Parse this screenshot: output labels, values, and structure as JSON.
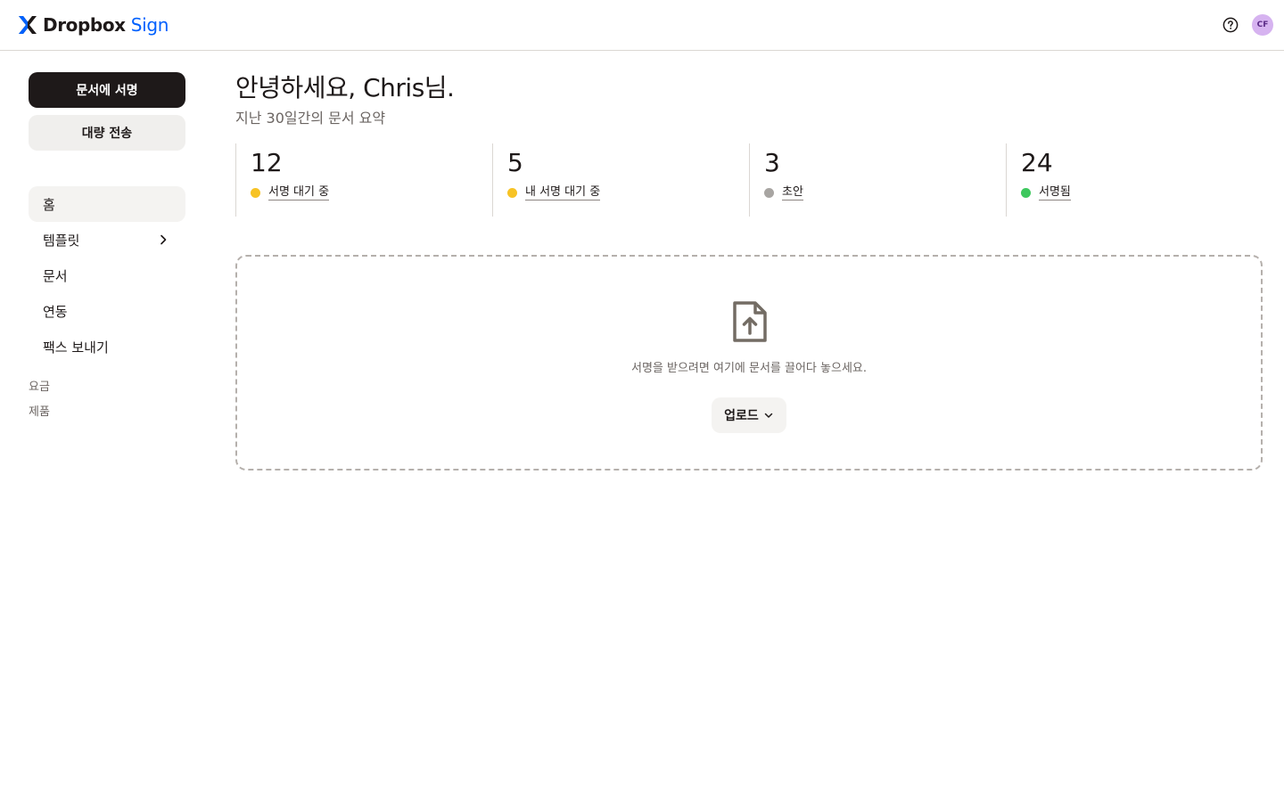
{
  "header": {
    "logo_text": "Dropbox",
    "logo_product": "Sign",
    "help_icon": "question-circle-icon",
    "avatar_initials": "CF",
    "avatar_color": "#d6b3f0"
  },
  "sidebar": {
    "primary_button": "문서에 서명",
    "secondary_button": "대량 전송",
    "nav_items": [
      {
        "label": "홈",
        "active": true
      },
      {
        "label": "템플릿",
        "icon": "chevron-right-icon"
      },
      {
        "label": "문서"
      },
      {
        "label": "연동"
      },
      {
        "label": "팩스 보내기"
      }
    ],
    "secondary_links": [
      "요금",
      "제품"
    ]
  },
  "main": {
    "greeting": "안녕하세요, Chris님.",
    "subtitle": "지난 30일간의 문서 요약",
    "stats": [
      {
        "count": "12",
        "label": "서명 대기 중",
        "color": "#f7c325"
      },
      {
        "count": "5",
        "label": "내 서명 대기 중",
        "color": "#f7c325"
      },
      {
        "count": "3",
        "label": "초안",
        "color": "#a8a5a2"
      },
      {
        "count": "24",
        "label": "서명됨",
        "color": "#3ec85e"
      }
    ],
    "dropzone": {
      "icon": "file-upload-icon",
      "text": "서명을 받으려면 여기에 문서를 끌어다 놓으세요.",
      "upload_button": "업로드",
      "upload_icon": "chevron-down-icon"
    }
  },
  "colors": {
    "brand_blue": "#0061fe",
    "primary_button_bg": "#1e1919"
  }
}
